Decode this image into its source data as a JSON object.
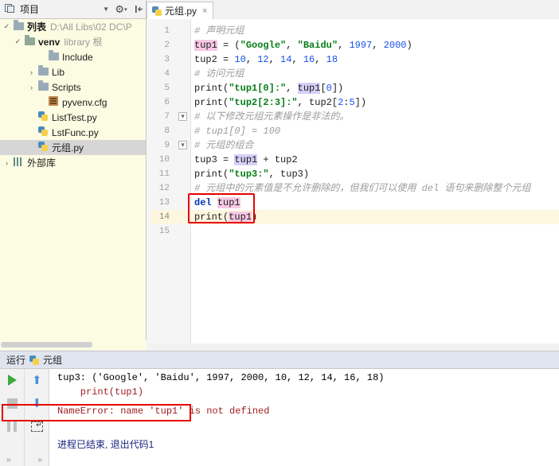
{
  "window": {
    "project_panel_title": "项目",
    "toolbar_icons": [
      "project-icon",
      "chevron-down-icon",
      "gear-icon",
      "collapse-icon"
    ]
  },
  "tabs": [
    {
      "label": "元组.py",
      "icon": "python-file-icon",
      "close": "×",
      "active": true
    }
  ],
  "tree": {
    "items": [
      {
        "indent": 0,
        "arrow": "v",
        "icon": "folder-icon",
        "label": "列表",
        "sub": "D:\\All Libs\\02 DC\\P",
        "bold": true,
        "selected": false
      },
      {
        "indent": 1,
        "arrow": "v",
        "icon": "folder-green-icon",
        "label": "venv",
        "sub": "library 根",
        "bold": true,
        "selected": false
      },
      {
        "indent": 2,
        "arrow": "",
        "icon": "folder-icon",
        "label": "Include",
        "sub": "",
        "bold": false,
        "selected": false
      },
      {
        "indent": 2,
        "arrow": ">",
        "icon": "folder-icon",
        "label": "Lib",
        "sub": "",
        "bold": false,
        "selected": false
      },
      {
        "indent": 2,
        "arrow": ">",
        "icon": "folder-icon",
        "label": "Scripts",
        "sub": "",
        "bold": false,
        "selected": false
      },
      {
        "indent": 2,
        "arrow": "",
        "icon": "config-file-icon",
        "label": "pyvenv.cfg",
        "sub": "",
        "bold": false,
        "selected": false
      },
      {
        "indent": 1,
        "arrow": "",
        "icon": "python-file-icon",
        "label": "ListTest.py",
        "sub": "",
        "bold": false,
        "selected": false
      },
      {
        "indent": 1,
        "arrow": "",
        "icon": "python-file-icon",
        "label": "LstFunc.py",
        "sub": "",
        "bold": false,
        "selected": false
      },
      {
        "indent": 1,
        "arrow": "",
        "icon": "python-file-icon",
        "label": "元组.py",
        "sub": "",
        "bold": false,
        "selected": true
      },
      {
        "indent": 0,
        "arrow": ">",
        "icon": "library-icon",
        "label": "外部库",
        "sub": "",
        "bold": false,
        "selected": false
      }
    ]
  },
  "editor": {
    "line_numbers": [
      "1",
      "2",
      "3",
      "4",
      "5",
      "6",
      "7",
      "8",
      "9",
      "10",
      "11",
      "12",
      "13",
      "14",
      "15"
    ],
    "highlighted_line": "14",
    "lines": [
      {
        "n": 1,
        "text": "# 声明元组"
      },
      {
        "n": 2,
        "text": "tup1 = (\"Google\", \"Baidu\", 1997, 2000)"
      },
      {
        "n": 3,
        "text": "tup2 = 10, 12, 14, 16, 18"
      },
      {
        "n": 4,
        "text": "# 访问元组"
      },
      {
        "n": 5,
        "text": "print(\"tup1[0]:\", tup1[0])"
      },
      {
        "n": 6,
        "text": "print(\"tup2[2:3]:\", tup2[2:5])"
      },
      {
        "n": 7,
        "text": "# 以下修改元组元素操作是非法的。"
      },
      {
        "n": 8,
        "text": "# tup1[0] = 100"
      },
      {
        "n": 9,
        "text": "# 元组的组合"
      },
      {
        "n": 10,
        "text": "tup3 = tup1 + tup2"
      },
      {
        "n": 11,
        "text": "print(\"tup3:\", tup3)"
      },
      {
        "n": 12,
        "text": "# 元组中的元素值是不允许删除的，但我们可以使用 del 语句来删除整个元组"
      },
      {
        "n": 13,
        "text": "del tup1"
      },
      {
        "n": 14,
        "text": "print(tup1)"
      },
      {
        "n": 15,
        "text": ""
      }
    ],
    "annotation": "red-rectangle-around-del-statement"
  },
  "run_panel": {
    "title": "运行",
    "config_name": "元组",
    "toolbar": [
      "run-icon",
      "stop-icon",
      "pause-icon",
      "scroll-up-icon",
      "scroll-down-icon",
      "soft-wrap-icon",
      "more-icon"
    ],
    "output_lines": [
      {
        "text": "tup3: ('Google', 'Baidu', 1997, 2000, 10, 12, 14, 16, 18)",
        "style": "normal"
      },
      {
        "text": "    print(tup1)",
        "style": "error"
      },
      {
        "text": "NameError: name 'tup1' is not defined",
        "style": "error"
      },
      {
        "text": "进程已结束, 退出代码1",
        "style": "blue"
      }
    ],
    "annotation": "red-rectangle-around-nameerror"
  },
  "colors": {
    "error_box": "#e60000",
    "keyword": "#0033b3",
    "string": "#067d17",
    "number": "#1750eb",
    "comment": "#9b9b9b",
    "tree_background": "#fcfce3",
    "run_header": "#dfe4ee"
  }
}
